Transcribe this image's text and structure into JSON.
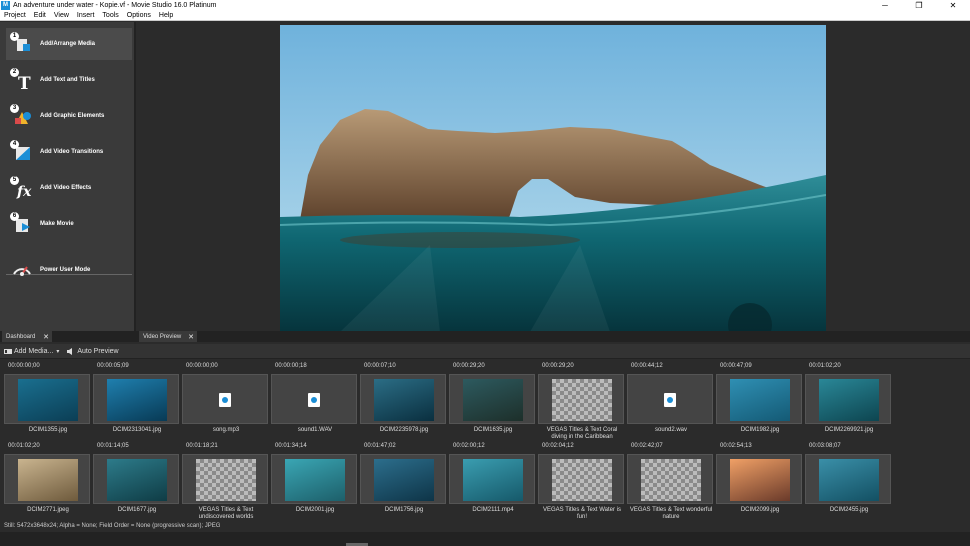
{
  "window": {
    "title": "An adventure under water - Kopie.vf - Movie Studio 16.0 Platinum",
    "app_icon": "movie-studio-icon",
    "minimize": "─",
    "maximize": "❐",
    "close": "✕"
  },
  "menu": [
    "Project",
    "Edit",
    "View",
    "Insert",
    "Tools",
    "Options",
    "Help"
  ],
  "dashboard": {
    "items": [
      {
        "num": "1",
        "label": "Add/Arrange Media",
        "icon": "add-media-icon",
        "active": true
      },
      {
        "num": "2",
        "label": "Add Text and Titles",
        "icon": "text-icon"
      },
      {
        "num": "3",
        "label": "Add Graphic Elements",
        "icon": "graphic-icon"
      },
      {
        "num": "4",
        "label": "Add Video Transitions",
        "icon": "transition-icon"
      },
      {
        "num": "5",
        "label": "Add Video Effects",
        "icon": "fx-icon"
      },
      {
        "num": "6",
        "label": "Make Movie",
        "icon": "make-movie-icon"
      },
      {
        "num": "",
        "label": "Power User Mode",
        "icon": "power-user-icon"
      }
    ]
  },
  "tabs": {
    "dashboard": "Dashboard",
    "video_preview": "Video Preview"
  },
  "toolbar": {
    "add_media": "Add Media...",
    "auto_preview": "Auto Preview"
  },
  "clips": [
    {
      "time": "00:00:00;00",
      "name": "DCIM1355.jpg",
      "kind": "photo"
    },
    {
      "time": "00:00:05;09",
      "name": "DCIM2313041.jpg",
      "kind": "photo"
    },
    {
      "time": "00:00:00;00",
      "name": "song.mp3",
      "kind": "audio"
    },
    {
      "time": "00:00:00;18",
      "name": "sound1.WAV",
      "kind": "audio"
    },
    {
      "time": "00:00:07;10",
      "name": "DCIM2235978.jpg",
      "kind": "photo"
    },
    {
      "time": "00:00:29;20",
      "name": "DCIM1635.jpg",
      "kind": "photo"
    },
    {
      "time": "00:00:29;20",
      "name": "VEGAS Titles & Text Coral diving in the Caribbean",
      "kind": "title"
    },
    {
      "time": "00:00:44;12",
      "name": "sound2.wav",
      "kind": "audio"
    },
    {
      "time": "00:00:47;09",
      "name": "DCIM1982.jpg",
      "kind": "photo"
    },
    {
      "time": "00:01:02;20",
      "name": "DCIM2269921.jpg",
      "kind": "photo"
    },
    {
      "time": "00:01:02;20",
      "name": "DCIM2771.jpeg",
      "kind": "photo"
    },
    {
      "time": "00:01:14;05",
      "name": "DCIM1677.jpg",
      "kind": "photo"
    },
    {
      "time": "00:01:18;21",
      "name": "VEGAS Titles & Text undiscovered worlds",
      "kind": "title"
    },
    {
      "time": "00:01:34;14",
      "name": "DCIM2001.jpg",
      "kind": "photo"
    },
    {
      "time": "00:01:47;02",
      "name": "DCIM1756.jpg",
      "kind": "photo"
    },
    {
      "time": "00:02:00;12",
      "name": "DCIM2111.mp4",
      "kind": "photo"
    },
    {
      "time": "00:02:04;12",
      "name": "VEGAS Titles & Text Water is fun!",
      "kind": "title"
    },
    {
      "time": "00:02:42;07",
      "name": "VEGAS Titles & Text wonderful nature",
      "kind": "title"
    },
    {
      "time": "00:02:54;13",
      "name": "DCIM2099.jpg",
      "kind": "photo"
    },
    {
      "time": "00:03:08;07",
      "name": "DCIM2455.jpg",
      "kind": "photo"
    }
  ],
  "status": "Still: 5472x3648x24; Alpha = None; Field Order = None (progressive scan); JPEG"
}
